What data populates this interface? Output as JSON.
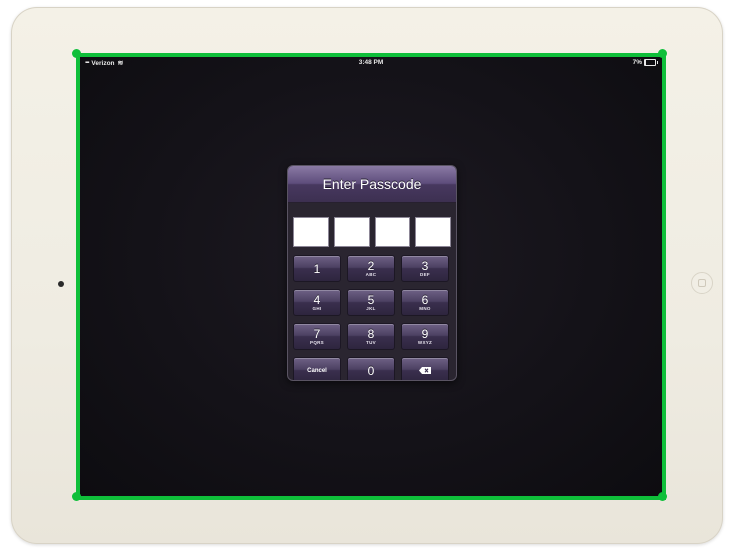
{
  "status_bar": {
    "carrier": "Verizon",
    "signal_icon": "signal-bars-icon",
    "wifi_icon": "wifi-icon",
    "time": "3:48 PM",
    "battery_percent": "7%",
    "battery_level": 0.07
  },
  "dialog": {
    "title": "Enter Passcode",
    "code_fields": [
      "",
      "",
      "",
      ""
    ]
  },
  "keypad": {
    "keys": [
      {
        "digit": "1",
        "letters": ""
      },
      {
        "digit": "2",
        "letters": "ABC"
      },
      {
        "digit": "3",
        "letters": "DEF"
      },
      {
        "digit": "4",
        "letters": "GHI"
      },
      {
        "digit": "5",
        "letters": "JKL"
      },
      {
        "digit": "6",
        "letters": "MNO"
      },
      {
        "digit": "7",
        "letters": "PQRS"
      },
      {
        "digit": "8",
        "letters": "TUV"
      },
      {
        "digit": "9",
        "letters": "WXYZ"
      }
    ],
    "cancel_label": "Cancel",
    "zero": "0",
    "delete_icon": "backspace-icon"
  },
  "colors": {
    "outline": "#0fbf3a",
    "dialog_header": "#5e4d7c",
    "screen_background": "#141218"
  }
}
